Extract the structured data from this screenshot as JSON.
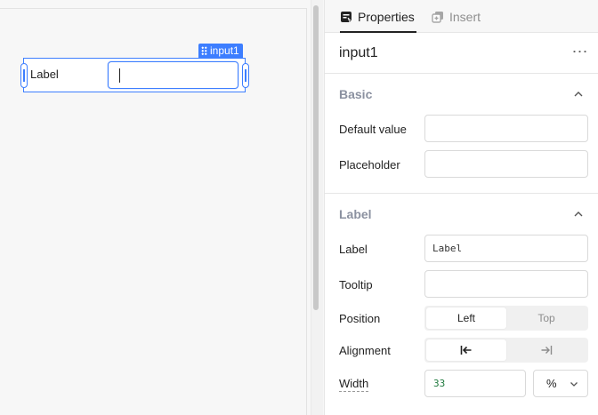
{
  "canvas": {
    "widget": {
      "name_tag": "input1",
      "label": "Label",
      "input_value": ""
    }
  },
  "panel": {
    "tabs": [
      {
        "label": "Properties",
        "icon": "properties-icon",
        "active": true
      },
      {
        "label": "Insert",
        "icon": "insert-icon",
        "active": false
      }
    ],
    "component_name": "input1",
    "more_icon": "⋯",
    "basic": {
      "title": "Basic",
      "default_value_label": "Default value",
      "default_value": "",
      "placeholder_label": "Placeholder",
      "placeholder_value": ""
    },
    "label_section": {
      "title": "Label",
      "label_label": "Label",
      "label_value": "Label",
      "tooltip_label": "Tooltip",
      "tooltip_value": "",
      "position_label": "Position",
      "position_options": [
        "Left",
        "Top"
      ],
      "position_selected": "Left",
      "alignment_label": "Alignment",
      "alignment_options": [
        "align-left-icon",
        "align-right-icon"
      ],
      "alignment_selected": "align-left-icon",
      "width_label": "Width",
      "width_value": "33",
      "width_unit": "%"
    }
  },
  "colors": {
    "accent": "#3d7eff",
    "section_title": "#8b91a0",
    "width_value": "#1f7a3e"
  }
}
